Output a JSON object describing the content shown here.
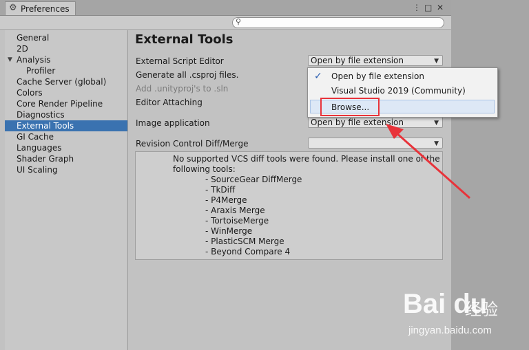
{
  "window": {
    "tab_title": "Preferences",
    "controls": {
      "menu": "⋮",
      "maximize": "□",
      "close": "✕"
    }
  },
  "sidebar": {
    "items": [
      {
        "label": "General"
      },
      {
        "label": "2D"
      },
      {
        "label": "Analysis",
        "expanded": true
      },
      {
        "label": "Profiler"
      },
      {
        "label": "Cache Server (global)"
      },
      {
        "label": "Colors"
      },
      {
        "label": "Core Render Pipeline"
      },
      {
        "label": "Diagnostics"
      },
      {
        "label": "External Tools",
        "selected": true
      },
      {
        "label": "GI Cache"
      },
      {
        "label": "Languages"
      },
      {
        "label": "Shader Graph"
      },
      {
        "label": "UI Scaling"
      }
    ]
  },
  "content": {
    "heading": "External Tools",
    "external_script_editor": {
      "label": "External Script Editor",
      "value": "Open by file extension"
    },
    "generate_csproj_label": "Generate all .csproj files.",
    "add_unityproj_label": "Add .unityproj's to .sln",
    "editor_attaching_label": "Editor Attaching",
    "image_application": {
      "label": "Image application",
      "value": "Open by file extension"
    },
    "revision_control": {
      "label": "Revision Control Diff/Merge",
      "value": ""
    },
    "help": {
      "message": "No supported VCS diff tools were found. Please install one of the following tools:",
      "tools": [
        "- SourceGear DiffMerge",
        "- TkDiff",
        "- P4Merge",
        "- Araxis Merge",
        "- TortoiseMerge",
        "- WinMerge",
        "- PlasticSCM Merge",
        "- Beyond Compare 4"
      ]
    }
  },
  "popup_menu": {
    "items": [
      {
        "label": "Open by file extension",
        "checked": true
      },
      {
        "label": "Visual Studio 2019 (Community)",
        "checked": false
      },
      {
        "label": "Browse...",
        "checked": false,
        "highlighted": true
      }
    ],
    "check_glyph": "✓"
  },
  "annotation": {
    "color": "#e8333a"
  },
  "watermark": {
    "logo": "Bai du",
    "brand_cn": "经验",
    "url": "jingyan.baidu.com"
  },
  "colors": {
    "selection": "#3a72b0",
    "window_bg": "#c2c2c2"
  }
}
